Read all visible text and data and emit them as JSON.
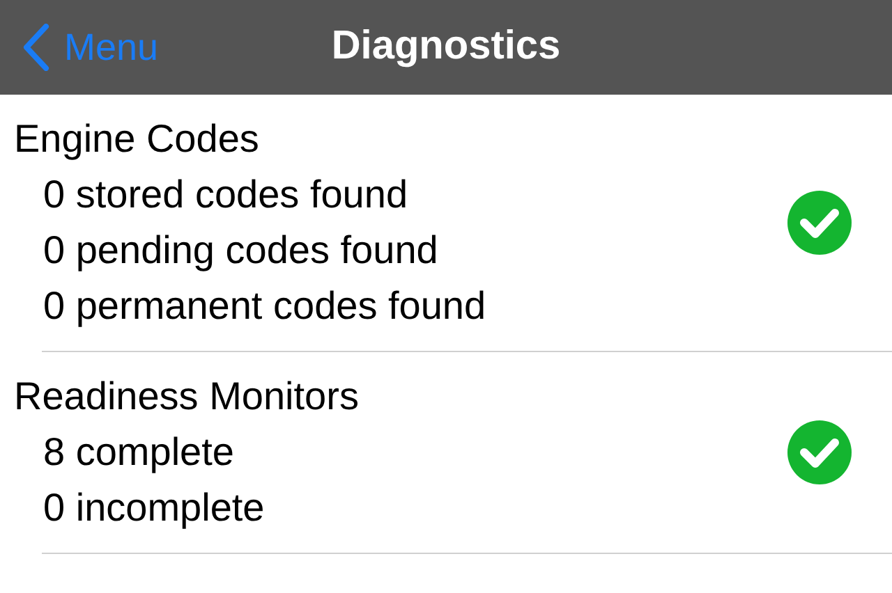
{
  "nav_bar": {
    "back": "Menu",
    "title": "Diagnostics"
  },
  "sections": [
    {
      "title": "Engine Codes",
      "lines": [
        "0 stored codes found",
        "0 pending codes found",
        "0 permanent codes found"
      ],
      "passed": true
    },
    {
      "title": "Readiness Monitors",
      "lines": [
        "8 complete",
        "0 incomplete"
      ],
      "passed": true
    }
  ]
}
